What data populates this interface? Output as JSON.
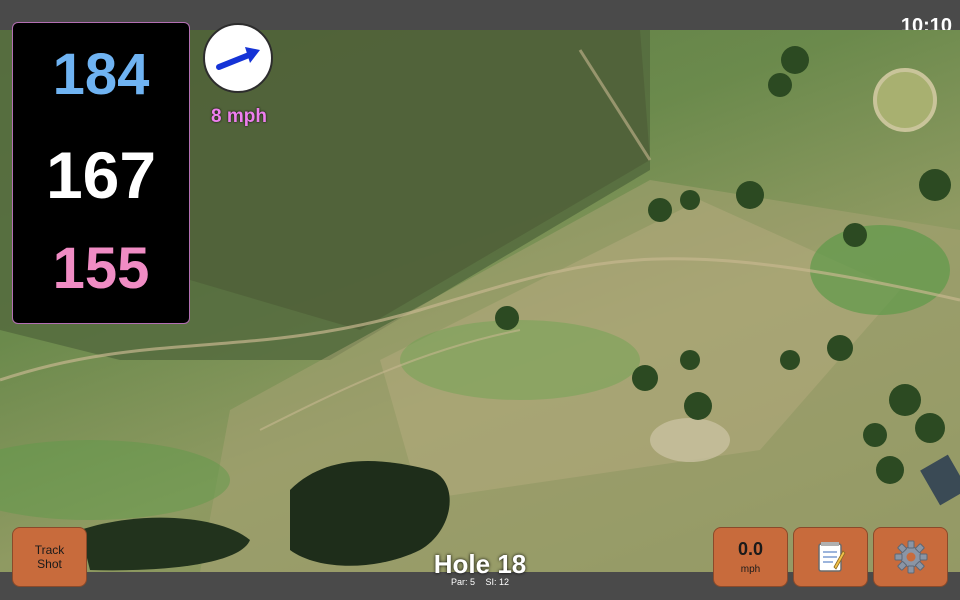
{
  "status": {
    "time": "10:10"
  },
  "distances": {
    "back": "184",
    "center": "167",
    "front": "155"
  },
  "wind": {
    "speed_label": "8 mph",
    "icon": "wind-direction-arrow-icon"
  },
  "buttons": {
    "track_shot_line1": "Track",
    "track_shot_line2": "Shot",
    "speed_value": "0.0",
    "speed_unit": "mph",
    "notes_icon": "notepad-icon",
    "settings_icon": "gear-icon"
  },
  "hole": {
    "title": "Hole 18",
    "par": "Par: 5",
    "si": "SI: 12"
  },
  "colors": {
    "back": "#6fb3f2",
    "center": "#ffffff",
    "front": "#f08cc4",
    "wind_text": "#ee7fee",
    "button": "#c86b3c",
    "bar": "#4a4a4a"
  }
}
